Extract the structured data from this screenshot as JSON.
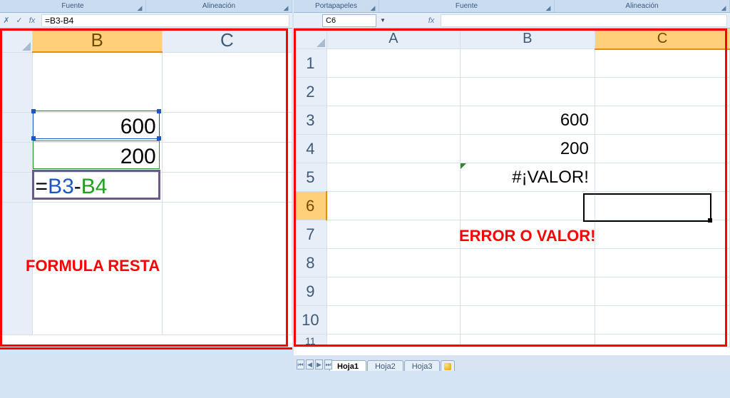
{
  "ribbon": {
    "left_groups": [
      "Fuente",
      "Alineación"
    ],
    "right_groups": [
      "Portapapeles",
      "Fuente",
      "Alineación"
    ]
  },
  "formula_bar": {
    "left": {
      "name_box": "",
      "fx_label": "fx",
      "formula": "=B3-B4"
    },
    "right": {
      "name_box": "C6",
      "fx_label": "fx",
      "formula": ""
    },
    "check": "✓",
    "cross": "✗",
    "dropdown": "▼"
  },
  "left_panel": {
    "columns": [
      "B",
      "C"
    ],
    "selected_col_index": 0,
    "cells": {
      "B3": "600",
      "B4": "200",
      "B5_formula_parts": {
        "eq": "=",
        "ref1": "B3",
        "minus": "-",
        "ref2": "B4"
      }
    },
    "overlay_text": "FORMULA RESTA"
  },
  "right_panel": {
    "columns": [
      "A",
      "B",
      "C"
    ],
    "rows": [
      1,
      2,
      3,
      4,
      5,
      6,
      7,
      8,
      9,
      10,
      11
    ],
    "selected_col_index": 2,
    "selected_row": 6,
    "cells": {
      "B3": "600",
      "B4": "200",
      "B5": "#¡VALOR!"
    },
    "overlay_text": "ERROR O  VALOR!"
  },
  "tabs": {
    "items": [
      "Hoja1",
      "Hoja2",
      "Hoja3"
    ],
    "active_index": 0
  },
  "chart_data": {
    "type": "table",
    "title": "Excel subtraction formula example",
    "left": {
      "B3": 600,
      "B4": 200,
      "B5_formula": "=B3-B4"
    },
    "right": {
      "B3": 600,
      "B4": 200,
      "B5": "#¡VALOR!"
    }
  }
}
